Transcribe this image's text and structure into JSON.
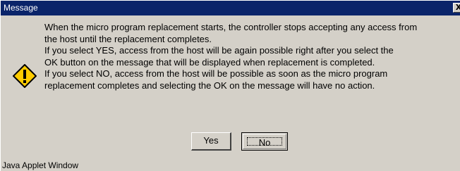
{
  "window": {
    "title": "Message",
    "close_glyph": "X",
    "status_text": "Java Applet Window"
  },
  "icon": "warning-icon",
  "message": {
    "lines": [
      "When the micro program replacement starts, the controller stops accepting any access from",
      "the host until the replacement completes.",
      "If you select YES, access from the host will be again possible right after you select the",
      "OK button on the message that will be displayed when replacement is completed.",
      "If you select NO, access from the host will be possible as soon as the micro program",
      "replacement completes and selecting the OK on the message will have no action."
    ]
  },
  "buttons": {
    "yes_label": "Yes",
    "no_label": "No"
  },
  "colors": {
    "titlebar": "#0a246a",
    "face": "#d4d0c8",
    "icon_fill": "#ffcc00"
  }
}
